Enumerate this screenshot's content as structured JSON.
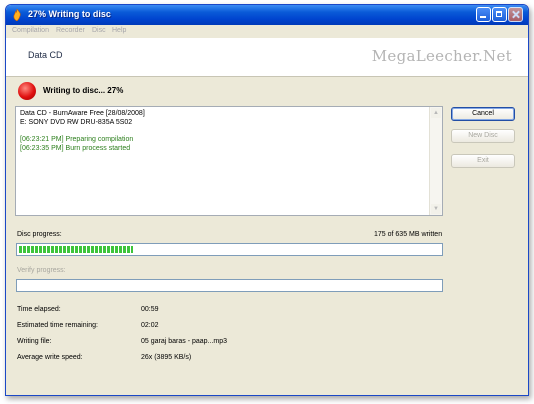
{
  "window": {
    "title": "27% Writing to disc",
    "menu": [
      "Compilation",
      "Recorder",
      "Disc",
      "Help"
    ]
  },
  "banner": {
    "title": "Data CD",
    "watermark": "MegaLeecher.Net"
  },
  "status": {
    "text": "Writing to disc... 27%"
  },
  "log": {
    "lines": [
      {
        "text": "Data CD - BurnAware Free [28/08/2008]",
        "color": "#000000"
      },
      {
        "text": "E: SONY DVD RW DRU-835A 5S02",
        "color": "#000000"
      },
      {
        "text": "[06:23:21 PM] Preparing compilation",
        "color": "#2c7f1c"
      },
      {
        "text": "[06:23:35 PM] Burn process started",
        "color": "#2c7f1c"
      }
    ]
  },
  "buttons": {
    "cancel": "Cancel",
    "new_disc": "New Disc",
    "exit": "Exit"
  },
  "disc_progress": {
    "label": "Disc progress:",
    "written": "175 of 635 MB written",
    "fraction": 0.27
  },
  "verify_progress": {
    "label": "Verify progress:",
    "fraction": 0
  },
  "stats": {
    "time_elapsed_label": "Time elapsed:",
    "time_elapsed": "00:59",
    "time_remaining_label": "Estimated time remaining:",
    "time_remaining": "02:02",
    "writing_file_label": "Writing file:",
    "writing_file": "05 garaj baras - paap...mp3",
    "speed_label": "Average write speed:",
    "speed": "26x (3895 KB/s)"
  },
  "icons": {
    "app": "burnaware-flame-icon",
    "status": "red-record-icon"
  },
  "colors": {
    "titlebar": "#0a5bd8",
    "progress_fill": "#3cc43a",
    "log_green": "#2c7f1c"
  }
}
